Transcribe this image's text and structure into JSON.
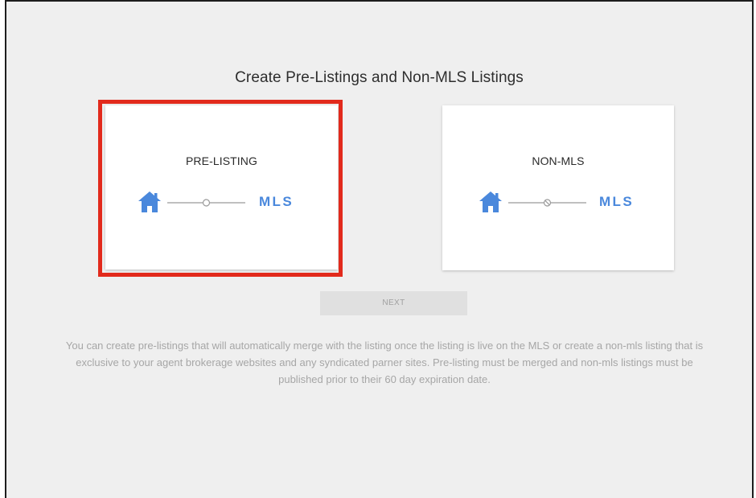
{
  "header": {
    "title": "Create Pre-Listings and Non-MLS Listings"
  },
  "cards": [
    {
      "title": "PRE-LISTING",
      "flow_from_icon": "house-icon",
      "flow_connector_icon": "empty-circle-icon",
      "flow_to": "MLS",
      "selected": true
    },
    {
      "title": "NON-MLS",
      "flow_from_icon": "house-icon",
      "flow_connector_icon": "prohibited-circle-icon",
      "flow_to": "MLS",
      "selected": false
    }
  ],
  "actions": {
    "next_label": "NEXT"
  },
  "description": "You can create pre-listings that will automatically merge with the listing once the listing is live on the MLS or create a non-mls listing that is exclusive to your agent brokerage websites and any syndicated parner sites. Pre-listing must be merged and non-mls listings must be published prior to their 60 day expiration date.",
  "colors": {
    "accent": "#4a88dc",
    "highlight": "#e22a1c",
    "background": "#efefef",
    "card": "#ffffff"
  }
}
